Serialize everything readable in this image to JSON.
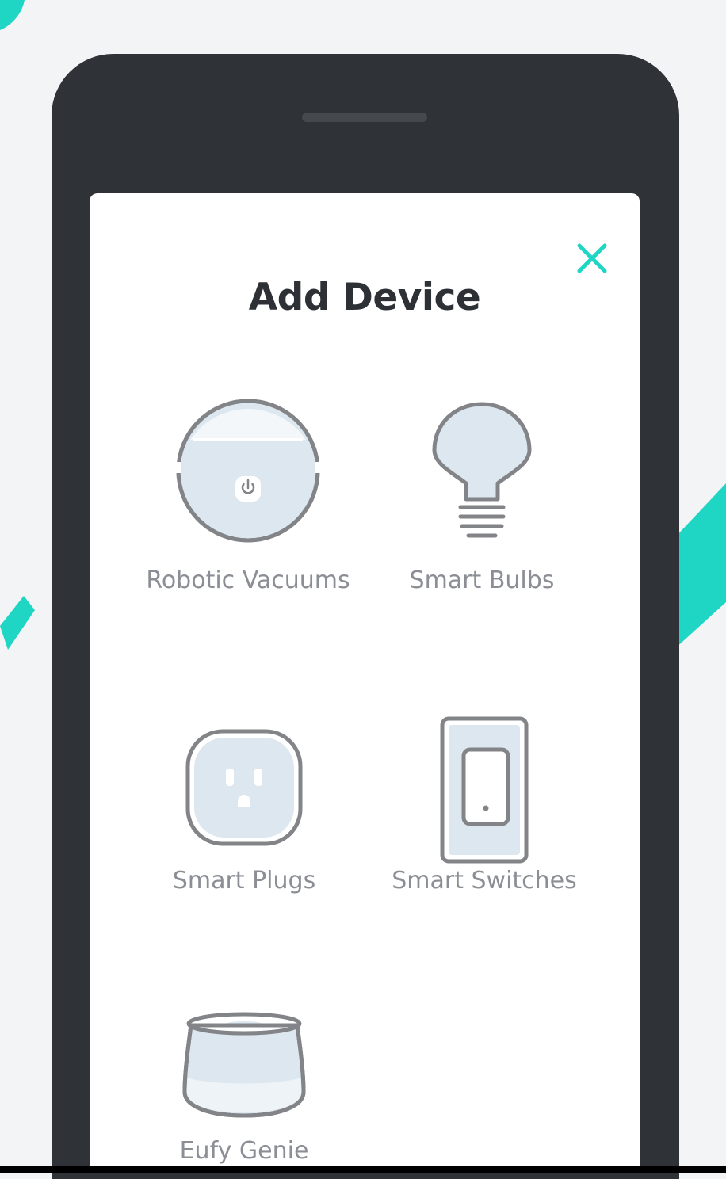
{
  "screen": {
    "title": "Add Device",
    "close_icon": "close-icon"
  },
  "devices": [
    {
      "label": "Robotic Vacuums",
      "icon": "robot-vacuum-icon"
    },
    {
      "label": "Smart Bulbs",
      "icon": "light-bulb-icon"
    },
    {
      "label": "Smart Plugs",
      "icon": "power-outlet-icon"
    },
    {
      "label": "Smart Switches",
      "icon": "light-switch-icon"
    },
    {
      "label": "Eufy Genie",
      "icon": "smart-speaker-icon"
    }
  ],
  "colors": {
    "accent": "#1fd6c4",
    "phone_body": "#2f3236",
    "icon_stroke": "#828488",
    "icon_fill": "#dce7ef",
    "title_text": "#2d3035",
    "label_text": "#8b8e94"
  }
}
